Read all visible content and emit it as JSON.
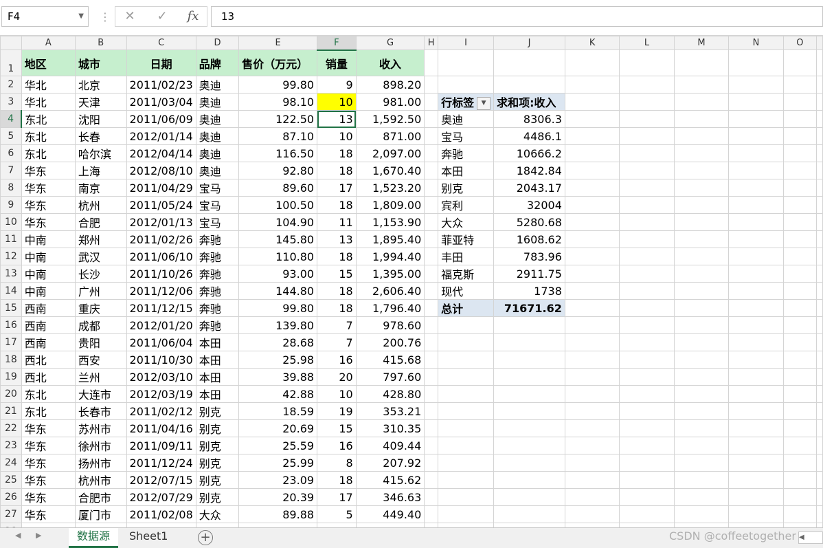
{
  "formula_bar": {
    "name_box": "F4",
    "separator": "⋮",
    "cancel_icon": "✕",
    "enter_icon": "✓",
    "fx_icon": "fx",
    "formula": "13"
  },
  "columns": [
    "A",
    "B",
    "C",
    "D",
    "E",
    "F",
    "G",
    "H",
    "I",
    "J",
    "K",
    "L",
    "M",
    "N",
    "O"
  ],
  "headers": [
    "地区",
    "城市",
    "日期",
    "品牌",
    "售价（万元）",
    "销量",
    "收入"
  ],
  "rows": [
    [
      "华北",
      "北京",
      "2011/02/23",
      "奥迪",
      "99.80",
      "9",
      "898.20"
    ],
    [
      "华北",
      "天津",
      "2011/03/04",
      "奥迪",
      "98.10",
      "10",
      "981.00"
    ],
    [
      "东北",
      "沈阳",
      "2011/06/09",
      "奥迪",
      "122.50",
      "13",
      "1,592.50"
    ],
    [
      "东北",
      "长春",
      "2012/01/14",
      "奥迪",
      "87.10",
      "10",
      "871.00"
    ],
    [
      "东北",
      "哈尔滨",
      "2012/04/14",
      "奥迪",
      "116.50",
      "18",
      "2,097.00"
    ],
    [
      "华东",
      "上海",
      "2012/08/10",
      "奥迪",
      "92.80",
      "18",
      "1,670.40"
    ],
    [
      "华东",
      "南京",
      "2011/04/29",
      "宝马",
      "89.60",
      "17",
      "1,523.20"
    ],
    [
      "华东",
      "杭州",
      "2011/05/24",
      "宝马",
      "100.50",
      "18",
      "1,809.00"
    ],
    [
      "华东",
      "合肥",
      "2012/01/13",
      "宝马",
      "104.90",
      "11",
      "1,153.90"
    ],
    [
      "中南",
      "郑州",
      "2011/02/26",
      "奔驰",
      "145.80",
      "13",
      "1,895.40"
    ],
    [
      "中南",
      "武汉",
      "2011/06/10",
      "奔驰",
      "110.80",
      "18",
      "1,994.40"
    ],
    [
      "中南",
      "长沙",
      "2011/10/26",
      "奔驰",
      "93.00",
      "15",
      "1,395.00"
    ],
    [
      "中南",
      "广州",
      "2011/12/06",
      "奔驰",
      "144.80",
      "18",
      "2,606.40"
    ],
    [
      "西南",
      "重庆",
      "2011/12/15",
      "奔驰",
      "99.80",
      "18",
      "1,796.40"
    ],
    [
      "西南",
      "成都",
      "2012/01/20",
      "奔驰",
      "139.80",
      "7",
      "978.60"
    ],
    [
      "西南",
      "贵阳",
      "2011/06/04",
      "本田",
      "28.68",
      "7",
      "200.76"
    ],
    [
      "西北",
      "西安",
      "2011/10/30",
      "本田",
      "25.98",
      "16",
      "415.68"
    ],
    [
      "西北",
      "兰州",
      "2012/03/10",
      "本田",
      "39.88",
      "20",
      "797.60"
    ],
    [
      "东北",
      "大连市",
      "2012/03/19",
      "本田",
      "42.88",
      "10",
      "428.80"
    ],
    [
      "东北",
      "长春市",
      "2011/02/12",
      "别克",
      "18.59",
      "19",
      "353.21"
    ],
    [
      "华东",
      "苏州市",
      "2011/04/16",
      "别克",
      "20.69",
      "15",
      "310.35"
    ],
    [
      "华东",
      "徐州市",
      "2011/09/11",
      "别克",
      "25.59",
      "16",
      "409.44"
    ],
    [
      "华东",
      "扬州市",
      "2011/12/24",
      "别克",
      "25.99",
      "8",
      "207.92"
    ],
    [
      "华东",
      "杭州市",
      "2012/07/15",
      "别克",
      "23.09",
      "18",
      "415.62"
    ],
    [
      "华东",
      "合肥市",
      "2012/07/29",
      "别克",
      "20.39",
      "17",
      "346.63"
    ],
    [
      "华东",
      "厦门市",
      "2011/02/08",
      "大众",
      "89.88",
      "5",
      "449.40"
    ]
  ],
  "pivot": {
    "row_label": "行标签",
    "sum_label": "求和项:收入",
    "items": [
      [
        "奥迪",
        "8306.3"
      ],
      [
        "宝马",
        "4486.1"
      ],
      [
        "奔驰",
        "10666.2"
      ],
      [
        "本田",
        "1842.84"
      ],
      [
        "别克",
        "2043.17"
      ],
      [
        "宾利",
        "32004"
      ],
      [
        "大众",
        "5280.68"
      ],
      [
        "菲亚特",
        "1608.62"
      ],
      [
        "丰田",
        "783.96"
      ],
      [
        "福克斯",
        "2911.75"
      ],
      [
        "现代",
        "1738"
      ]
    ],
    "total_label": "总计",
    "total_value": "71671.62"
  },
  "sheets": {
    "active": "数据源",
    "other": "Sheet1",
    "add_icon": "+"
  },
  "watermark": "CSDN @coffeetogether",
  "colors": {
    "header_fill": "#c6efce",
    "highlight": "#ffff00",
    "pivot_fill": "#dce6f1",
    "excel_green": "#217346"
  }
}
